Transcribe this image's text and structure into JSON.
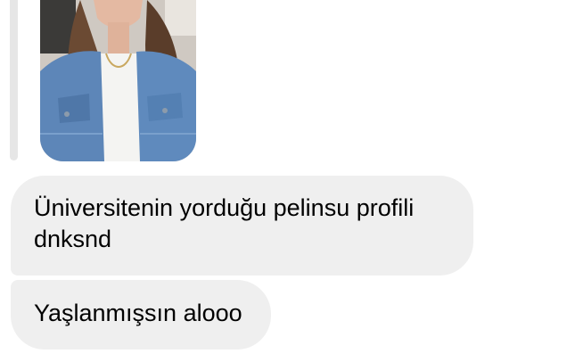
{
  "conversation": {
    "shared_photo": {
      "description_icon": "shared-photo"
    },
    "messages": [
      {
        "text": "Üniversitenin yorduğu pelinsu profili dnksnd"
      },
      {
        "text": "Yaşlanmışsın alooo"
      }
    ]
  },
  "colors": {
    "bubble_background": "#efefef",
    "reply_bar": "#e6e6e6",
    "text": "#000000"
  }
}
